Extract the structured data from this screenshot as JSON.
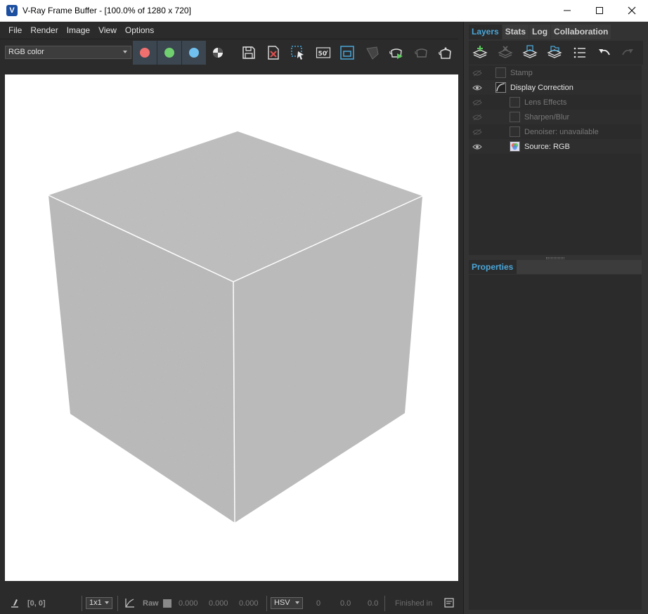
{
  "window": {
    "title": "V-Ray Frame Buffer - [100.0% of 1280 x 720]",
    "app_icon": "V",
    "controls": [
      "minimize-icon",
      "maximize-icon",
      "close-icon"
    ]
  },
  "menu": {
    "items": [
      "File",
      "Render",
      "Image",
      "View",
      "Options"
    ]
  },
  "toolbar": {
    "channel": "RGB color",
    "color_buttons": [
      {
        "name": "red-channel",
        "color": "#f07070"
      },
      {
        "name": "green-channel",
        "color": "#70d070"
      },
      {
        "name": "blue-channel",
        "color": "#70c0f0"
      }
    ],
    "compare_label": "50",
    "icons": [
      "mono-channel-icon",
      "save-image-icon",
      "clear-image-icon",
      "region-render-icon",
      "compare-icon",
      "frame-icon",
      "lens-icon",
      "render-interactive-icon",
      "stop-render-icon",
      "render-icon"
    ]
  },
  "statusbar": {
    "coords": "[0, 0]",
    "zoom": "1x1",
    "raw_label": "Raw",
    "r": "0.000",
    "g": "0.000",
    "b": "0.000",
    "color_mode": "HSV",
    "h": "0",
    "s": "0.0",
    "v": "0.0",
    "status": "Finished in"
  },
  "panel": {
    "tabs": [
      "Layers",
      "Stats",
      "Log",
      "Collaboration"
    ],
    "active_tab": "Layers",
    "layers": [
      {
        "label": "Stamp",
        "enabled": false,
        "indent": 0,
        "icon": "stamp-icon"
      },
      {
        "label": "Display Correction",
        "enabled": true,
        "indent": 0,
        "icon": "curve-icon"
      },
      {
        "label": "Lens Effects",
        "enabled": false,
        "indent": 1,
        "icon": "lens-effects-icon"
      },
      {
        "label": "Sharpen/Blur",
        "enabled": false,
        "indent": 1,
        "icon": "sharpen-icon"
      },
      {
        "label": "Denoiser: unavailable",
        "enabled": false,
        "indent": 1,
        "icon": "denoiser-icon"
      },
      {
        "label": "Source: RGB",
        "enabled": true,
        "indent": 1,
        "icon": "rgb-source-icon"
      }
    ],
    "properties_title": "Properties"
  },
  "colors": {
    "accent": "#4aa6d8",
    "cube_face": "#bcbcbc"
  }
}
